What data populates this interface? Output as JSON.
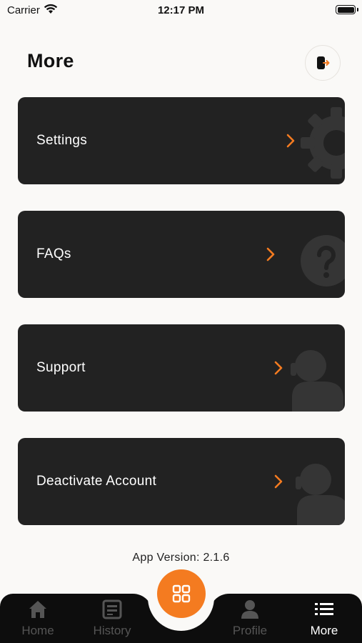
{
  "status": {
    "carrier": "Carrier",
    "time": "12:17 PM"
  },
  "header": {
    "title": "More",
    "logout_icon": "logout-icon"
  },
  "menu": [
    {
      "label": "Settings",
      "icon": "gear-icon"
    },
    {
      "label": "FAQs",
      "icon": "question-icon"
    },
    {
      "label": "Support",
      "icon": "support-icon"
    },
    {
      "label": "Deactivate Account",
      "icon": "support-icon"
    }
  ],
  "footer": {
    "version": "App Version: 2.1.6"
  },
  "tabs": [
    {
      "label": "Home",
      "icon": "home-icon"
    },
    {
      "label": "History",
      "icon": "history-icon"
    },
    {
      "label": "Profile",
      "icon": "profile-icon"
    },
    {
      "label": "More",
      "icon": "list-icon",
      "active": true
    }
  ],
  "colors": {
    "accent": "#f47b20",
    "card": "#222222",
    "background": "#faf9f7",
    "tabbar": "#0d0d0d"
  }
}
